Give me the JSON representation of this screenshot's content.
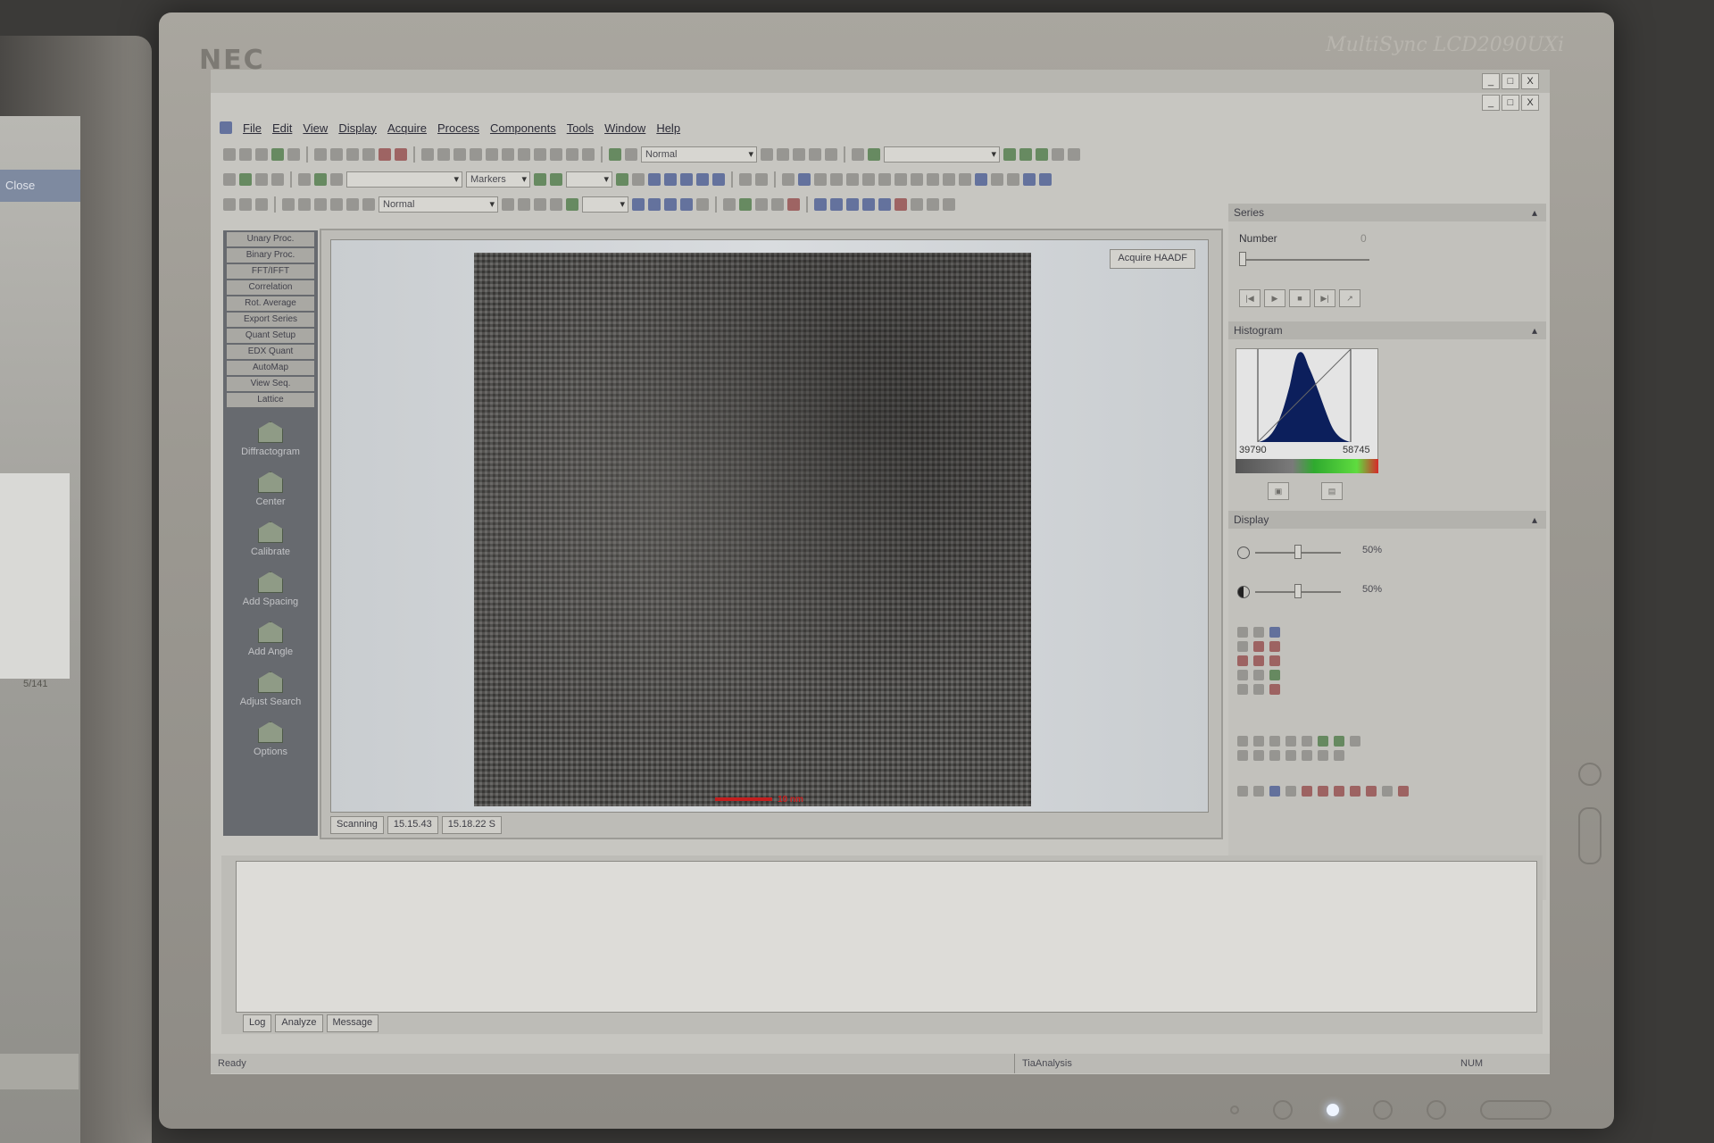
{
  "monitor": {
    "brand": "NEC",
    "model": "MultiSync LCD2090UXi"
  },
  "left_monitor": {
    "title_text": "Close",
    "value_text": "5/141"
  },
  "window": {
    "buttons": [
      "_",
      "□",
      "X"
    ]
  },
  "menu": [
    "File",
    "Edit",
    "View",
    "Display",
    "Acquire",
    "Process",
    "Components",
    "Tools",
    "Window",
    "Help"
  ],
  "toolbars": {
    "combo_normal_1": "Normal",
    "combo_markers": "Markers",
    "combo_normal_2": "Normal"
  },
  "function_panel": {
    "buttons": [
      "Unary Proc.",
      "Binary Proc.",
      "FFT/IFFT",
      "Correlation",
      "Rot. Average",
      "Export Series",
      "Quant Setup",
      "EDX Quant",
      "AutoMap",
      "View Seq.",
      "Lattice"
    ],
    "tools": [
      "Diffractogram",
      "Center",
      "Calibrate",
      "Add Spacing",
      "Add Angle",
      "Adjust Search",
      "Options"
    ]
  },
  "image_window": {
    "acquire_button": "Acquire HAADF",
    "scale_label": "10 nm",
    "tabs": [
      "Scanning",
      "15.15.43",
      "15.18.22 S"
    ]
  },
  "right_panel": {
    "series": {
      "title": "Series",
      "number_label": "Number",
      "number_value": "0"
    },
    "histogram": {
      "title": "Histogram",
      "min": "39790",
      "max": "58745"
    },
    "display": {
      "title": "Display",
      "brightness": "50%",
      "contrast": "50%"
    }
  },
  "output": {
    "tabs": [
      "Log",
      "Analyze",
      "Message"
    ]
  },
  "status": {
    "ready": "Ready",
    "app": "TiaAnalysis",
    "num": "NUM"
  },
  "colors": {
    "panel_bg": "#c7c6c1",
    "function_panel_bg": "#676a6f",
    "histogram_fill": "#0c1f5c",
    "scalebar": "#c41f1f"
  }
}
